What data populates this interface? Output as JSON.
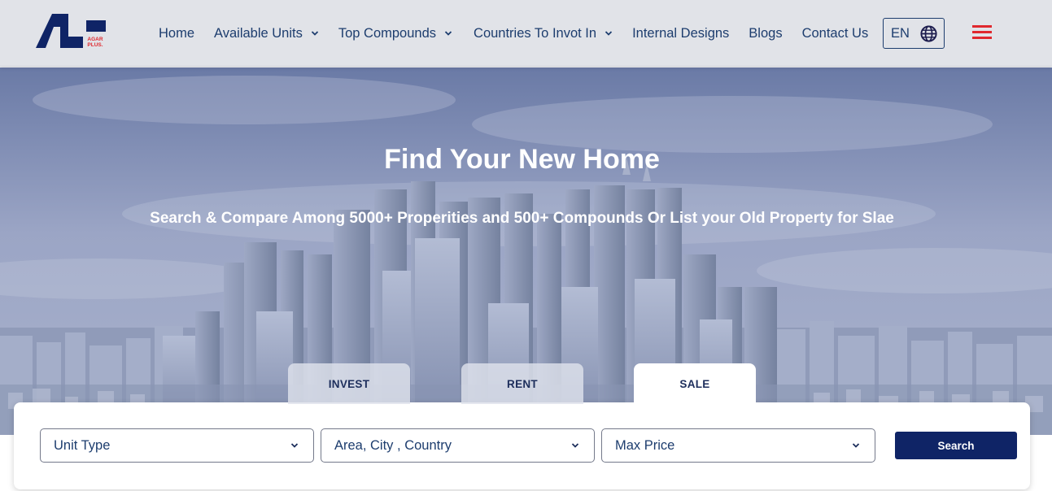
{
  "brand": {
    "logo_text": "AGAR PLUS."
  },
  "nav": {
    "items": [
      {
        "label": "Home",
        "has_dropdown": false
      },
      {
        "label": "Available Units",
        "has_dropdown": true
      },
      {
        "label": "Top Compounds",
        "has_dropdown": true
      },
      {
        "label": "Countries To Invot In",
        "has_dropdown": true
      },
      {
        "label": "Internal Designs",
        "has_dropdown": false
      },
      {
        "label": "Blogs",
        "has_dropdown": false
      },
      {
        "label": "Contact Us",
        "has_dropdown": false
      }
    ],
    "language": "EN",
    "language_icon": "globe-icon",
    "menu_icon": "hamburger-menu-icon"
  },
  "hero": {
    "title": "Find Your New Home",
    "subtitle": "Search & Compare Among 5000+ Properities and 500+ Compounds Or List your Old Property for Slae"
  },
  "tabs": [
    {
      "label": "INVEST",
      "active": false
    },
    {
      "label": "RENT",
      "active": false
    },
    {
      "label": "SALE",
      "active": true
    }
  ],
  "search": {
    "unit_type": "Unit Type",
    "location": "Area, City , Country",
    "max_price": "Max Price",
    "button_label": "Search"
  },
  "colors": {
    "primary": "#0f2466",
    "nav_text": "#1d3d6e",
    "accent_red": "#e0282e",
    "header_bg": "#e1e3e8"
  }
}
